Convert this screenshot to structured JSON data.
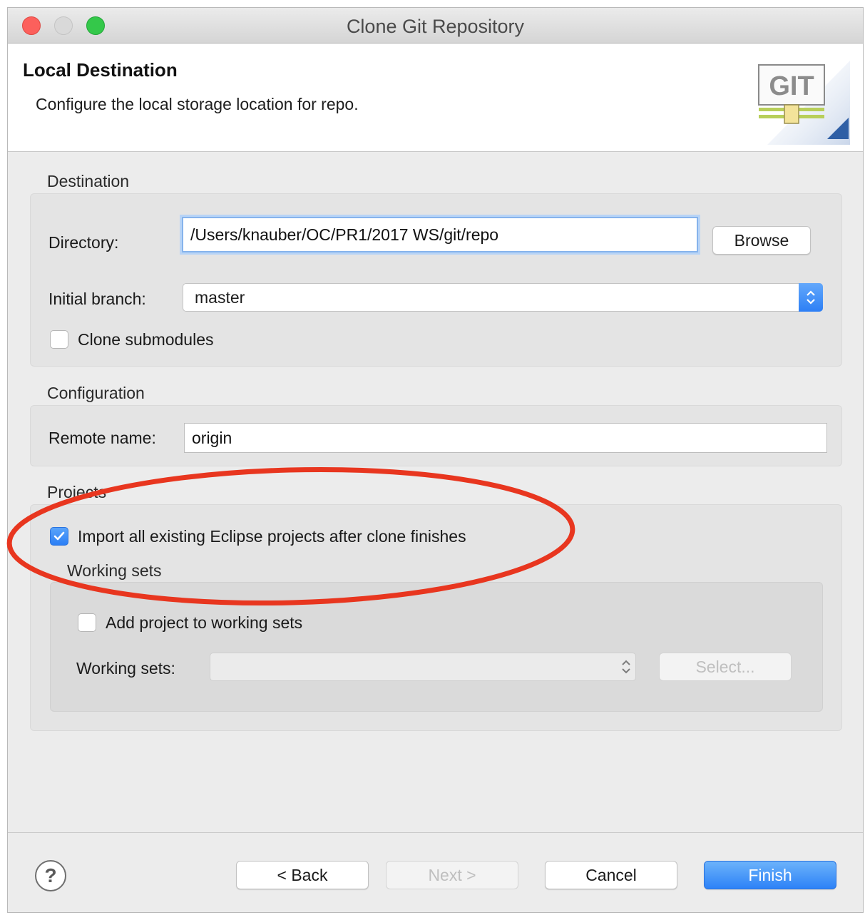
{
  "window": {
    "title": "Clone Git Repository"
  },
  "header": {
    "title": "Local Destination",
    "description": "Configure the local storage location for repo.",
    "logo_text": "GIT"
  },
  "destination": {
    "group_title": "Destination",
    "directory_label": "Directory:",
    "directory_value": "/Users/knauber/OC/PR1/2017 WS/git/repo",
    "browse_label": "Browse",
    "branch_label": "Initial branch:",
    "branch_value": "master",
    "clone_submodules_label": "Clone submodules",
    "clone_submodules_checked": false
  },
  "configuration": {
    "group_title": "Configuration",
    "remote_label": "Remote name:",
    "remote_value": "origin"
  },
  "projects": {
    "group_title": "Projects",
    "import_label": "Import all existing Eclipse projects after clone finishes",
    "import_checked": true,
    "working_sets_title": "Working sets",
    "add_to_ws_label": "Add project to working sets",
    "add_to_ws_checked": false,
    "ws_label": "Working sets:",
    "ws_value": "",
    "select_label": "Select..."
  },
  "footer": {
    "help_symbol": "?",
    "back_label": "< Back",
    "next_label": "Next >",
    "cancel_label": "Cancel",
    "finish_label": "Finish"
  },
  "colors": {
    "annotation": "#e8361f",
    "accent": "#2d82f7"
  }
}
